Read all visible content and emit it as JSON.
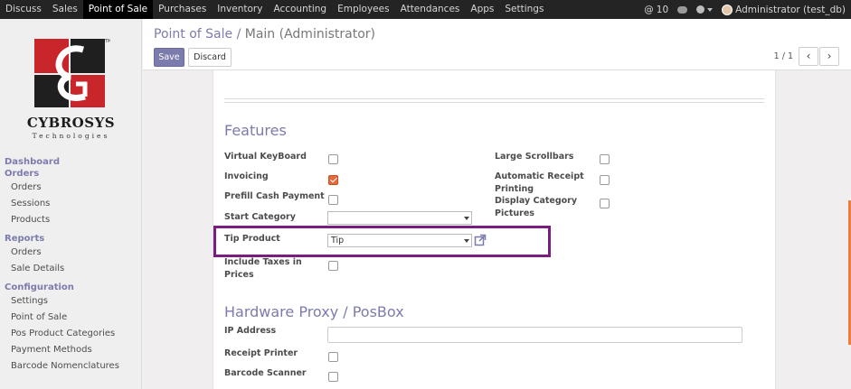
{
  "topnav": {
    "menu": [
      "Discuss",
      "Sales",
      "Point of Sale",
      "Purchases",
      "Inventory",
      "Accounting",
      "Employees",
      "Attendances",
      "Apps",
      "Settings"
    ],
    "active_index": 2,
    "notifications": "10",
    "user": "Administrator (test_db)"
  },
  "sidebar": {
    "logo_text": "CYBROSYS",
    "logo_sub": "Technologies",
    "logo_tm": "TM",
    "sections": [
      {
        "title": "Dashboard",
        "items": []
      },
      {
        "title": "Orders",
        "items": [
          "Orders",
          "Sessions",
          "Products"
        ]
      },
      {
        "title": "Reports",
        "items": [
          "Orders",
          "Sale Details"
        ]
      },
      {
        "title": "Configuration",
        "items": [
          "Settings",
          "Point of Sale",
          "Pos Product Categories",
          "Payment Methods",
          "Barcode Nomenclatures"
        ]
      }
    ]
  },
  "breadcrumb": {
    "parent": "Point of Sale",
    "separator": "/",
    "current": "Main (Administrator)"
  },
  "buttons": {
    "save": "Save",
    "discard": "Discard"
  },
  "pager": {
    "text": "1 / 1",
    "prev": "‹",
    "next": "›"
  },
  "features": {
    "title": "Features",
    "virtual_keyboard": {
      "label": "Virtual KeyBoard",
      "checked": false
    },
    "invoicing": {
      "label": "Invoicing",
      "checked": true
    },
    "prefill_cash": {
      "label": "Prefill Cash Payment",
      "checked": false
    },
    "start_category": {
      "label": "Start Category",
      "value": ""
    },
    "tip_product": {
      "label": "Tip Product",
      "value": "Tip"
    },
    "include_taxes": {
      "label_1": "Include Taxes in",
      "label_2": "Prices",
      "checked": false
    },
    "large_scrollbars": {
      "label": "Large Scrollbars",
      "checked": false
    },
    "auto_receipt": {
      "label_1": "Automatic Receipt",
      "label_2": "Printing",
      "checked": false
    },
    "display_category": {
      "label_1": "Display Category",
      "label_2": "Pictures",
      "checked": false
    }
  },
  "hardware": {
    "title": "Hardware Proxy / PosBox",
    "ip_address": {
      "label": "IP Address",
      "value": ""
    },
    "receipt_printer": {
      "label": "Receipt Printer",
      "checked": false
    },
    "barcode_scanner": {
      "label": "Barcode Scanner",
      "checked": false
    }
  },
  "colors": {
    "accent": "#7c7bad",
    "highlight": "#7b1c80",
    "checkbox_on": "#e26a3d",
    "topbar": "#242424"
  }
}
